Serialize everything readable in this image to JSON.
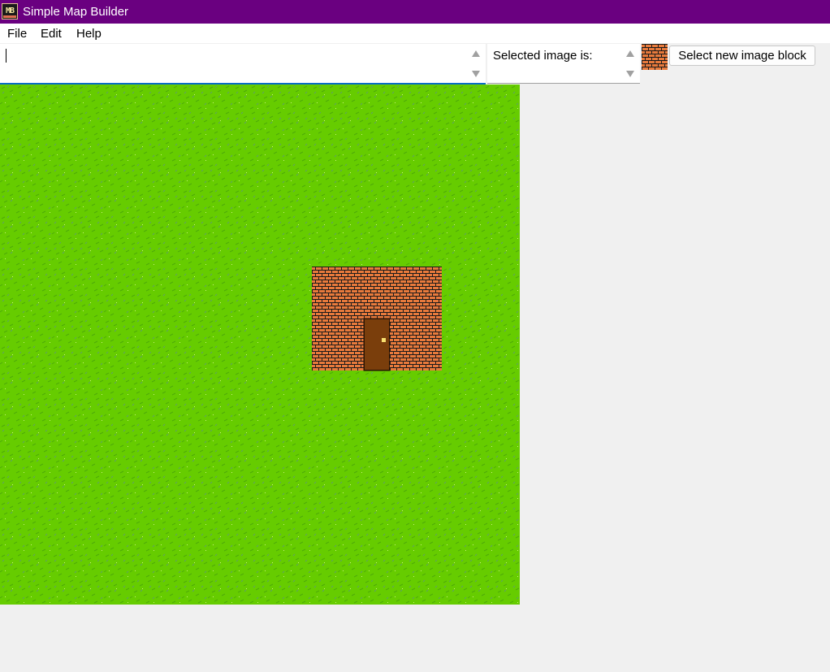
{
  "window": {
    "title": "Simple Map Builder",
    "icon": "map-builder-app-icon",
    "icon_text": "MB"
  },
  "menu": {
    "items": [
      {
        "label": "File"
      },
      {
        "label": "Edit"
      },
      {
        "label": "Help"
      }
    ]
  },
  "toolbar": {
    "input_value": "",
    "selected_label": "Selected image is:",
    "selected_tile": "brick",
    "select_button_label": "Select new image block"
  },
  "map": {
    "base_tile": "grass",
    "tiles": [
      {
        "row": 7,
        "col": 12,
        "type": "brick"
      },
      {
        "row": 7,
        "col": 13,
        "type": "brick"
      },
      {
        "row": 7,
        "col": 14,
        "type": "brick"
      },
      {
        "row": 7,
        "col": 15,
        "type": "brick"
      },
      {
        "row": 7,
        "col": 16,
        "type": "brick"
      },
      {
        "row": 8,
        "col": 12,
        "type": "brick"
      },
      {
        "row": 8,
        "col": 13,
        "type": "brick"
      },
      {
        "row": 8,
        "col": 14,
        "type": "brick"
      },
      {
        "row": 8,
        "col": 15,
        "type": "brick"
      },
      {
        "row": 8,
        "col": 16,
        "type": "brick"
      },
      {
        "row": 9,
        "col": 12,
        "type": "brick"
      },
      {
        "row": 9,
        "col": 13,
        "type": "brick"
      },
      {
        "row": 9,
        "col": 14,
        "type": "door"
      },
      {
        "row": 9,
        "col": 15,
        "type": "brick"
      },
      {
        "row": 9,
        "col": 16,
        "type": "brick"
      },
      {
        "row": 10,
        "col": 12,
        "type": "brick"
      },
      {
        "row": 10,
        "col": 13,
        "type": "brick"
      },
      {
        "row": 10,
        "col": 14,
        "type": "door"
      },
      {
        "row": 10,
        "col": 15,
        "type": "brick"
      },
      {
        "row": 10,
        "col": 16,
        "type": "brick"
      }
    ]
  },
  "colors": {
    "titlebar": "#6a0080",
    "grass": "#66cc00",
    "brick": "#e87a3c",
    "mortar": "#1a1a1a",
    "door": "#7a3e0c",
    "accent": "#0a6cc6"
  }
}
